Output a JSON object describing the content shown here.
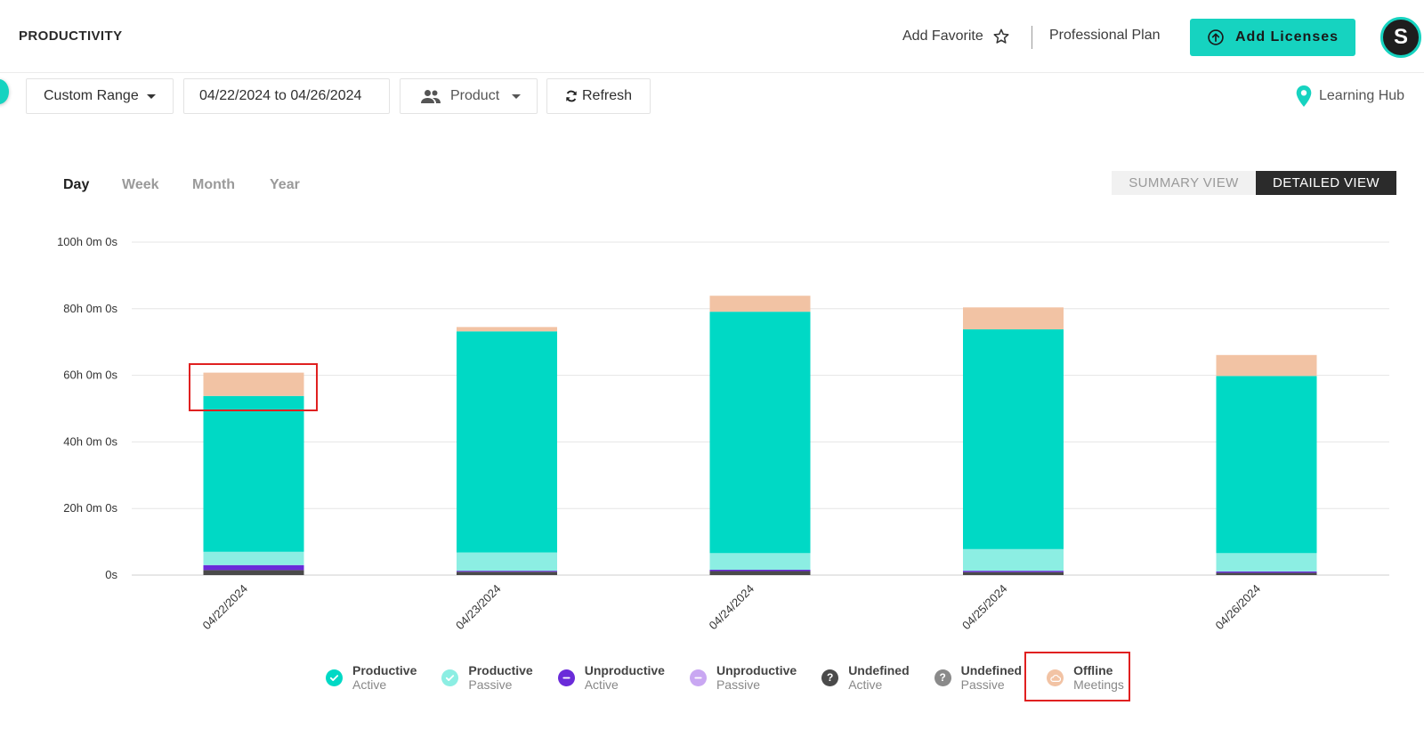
{
  "header": {
    "title": "PRODUCTIVITY",
    "add_favorite": "Add Favorite",
    "plan": "Professional Plan",
    "add_licenses": "Add Licenses",
    "avatar_letter": "S"
  },
  "toolbar": {
    "range": "Custom Range",
    "dates": "04/22/2024 to 04/26/2024",
    "product": "Product",
    "refresh": "Refresh",
    "learning_hub": "Learning Hub"
  },
  "tabs": [
    "Day",
    "Week",
    "Month",
    "Year"
  ],
  "active_tab": "Day",
  "view_toggle": {
    "summary": "SUMMARY VIEW",
    "detailed": "DETAILED VIEW",
    "active": "DETAILED VIEW"
  },
  "colors": {
    "accent": "#16d3c0",
    "productive_active": "#00d9c5",
    "productive_passive": "#8ceee3",
    "unproductive_active": "#6a2bd9",
    "unproductive_passive": "#c9a7f2",
    "undefined_active": "#4a4a4a",
    "undefined_passive": "#8a8a8a",
    "offline_meetings": "#f2c3a4",
    "highlight": "#e02020"
  },
  "chart_data": {
    "type": "bar",
    "stacked": true,
    "categories": [
      "04/22/2024",
      "04/23/2024",
      "04/24/2024",
      "04/25/2024",
      "04/26/2024"
    ],
    "y_ticks": [
      "0s",
      "20h 0m 0s",
      "40h 0m 0s",
      "60h 0m 0s",
      "80h 0m 0s",
      "100h 0m 0s"
    ],
    "ylim": [
      0,
      100
    ],
    "y_unit": "hours",
    "grid": true,
    "legend_position": "bottom",
    "series": [
      {
        "name": "Undefined Active",
        "color": "#4a4a4a",
        "values": [
          1.5,
          1.0,
          1.2,
          0.9,
          0.7
        ]
      },
      {
        "name": "Undefined Passive",
        "color": "#8a8a8a",
        "values": [
          0.0,
          0.0,
          0.0,
          0.0,
          0.0
        ]
      },
      {
        "name": "Unproductive Active",
        "color": "#6a2bd9",
        "values": [
          1.5,
          0.3,
          0.4,
          0.4,
          0.4
        ]
      },
      {
        "name": "Unproductive Passive",
        "color": "#c9a7f2",
        "values": [
          0.0,
          0.0,
          0.0,
          0.0,
          0.0
        ]
      },
      {
        "name": "Productive Passive",
        "color": "#8ceee3",
        "values": [
          4.0,
          5.5,
          5.0,
          6.5,
          5.5
        ]
      },
      {
        "name": "Productive Active",
        "color": "#00d9c5",
        "values": [
          46.8,
          66.4,
          72.5,
          66.0,
          53.2
        ]
      },
      {
        "name": "Offline Meetings",
        "color": "#f2c3a4",
        "values": [
          7.0,
          1.3,
          4.8,
          6.6,
          6.3
        ]
      }
    ]
  },
  "legend": [
    {
      "main": "Productive",
      "sub": "Active",
      "icon": "check-icon",
      "color": "#00d9c5"
    },
    {
      "main": "Productive",
      "sub": "Passive",
      "icon": "check-icon",
      "color": "#8ceee3"
    },
    {
      "main": "Unproductive",
      "sub": "Active",
      "icon": "minus-icon",
      "color": "#6a2bd9"
    },
    {
      "main": "Unproductive",
      "sub": "Passive",
      "icon": "minus-icon",
      "color": "#c9a7f2"
    },
    {
      "main": "Undefined",
      "sub": "Active",
      "icon": "question-icon",
      "color": "#4a4a4a"
    },
    {
      "main": "Undefined",
      "sub": "Passive",
      "icon": "question-icon",
      "color": "#8a8a8a"
    },
    {
      "main": "Offline",
      "sub": "Meetings",
      "icon": "cloud-icon",
      "color": "#f2c3a4"
    }
  ]
}
